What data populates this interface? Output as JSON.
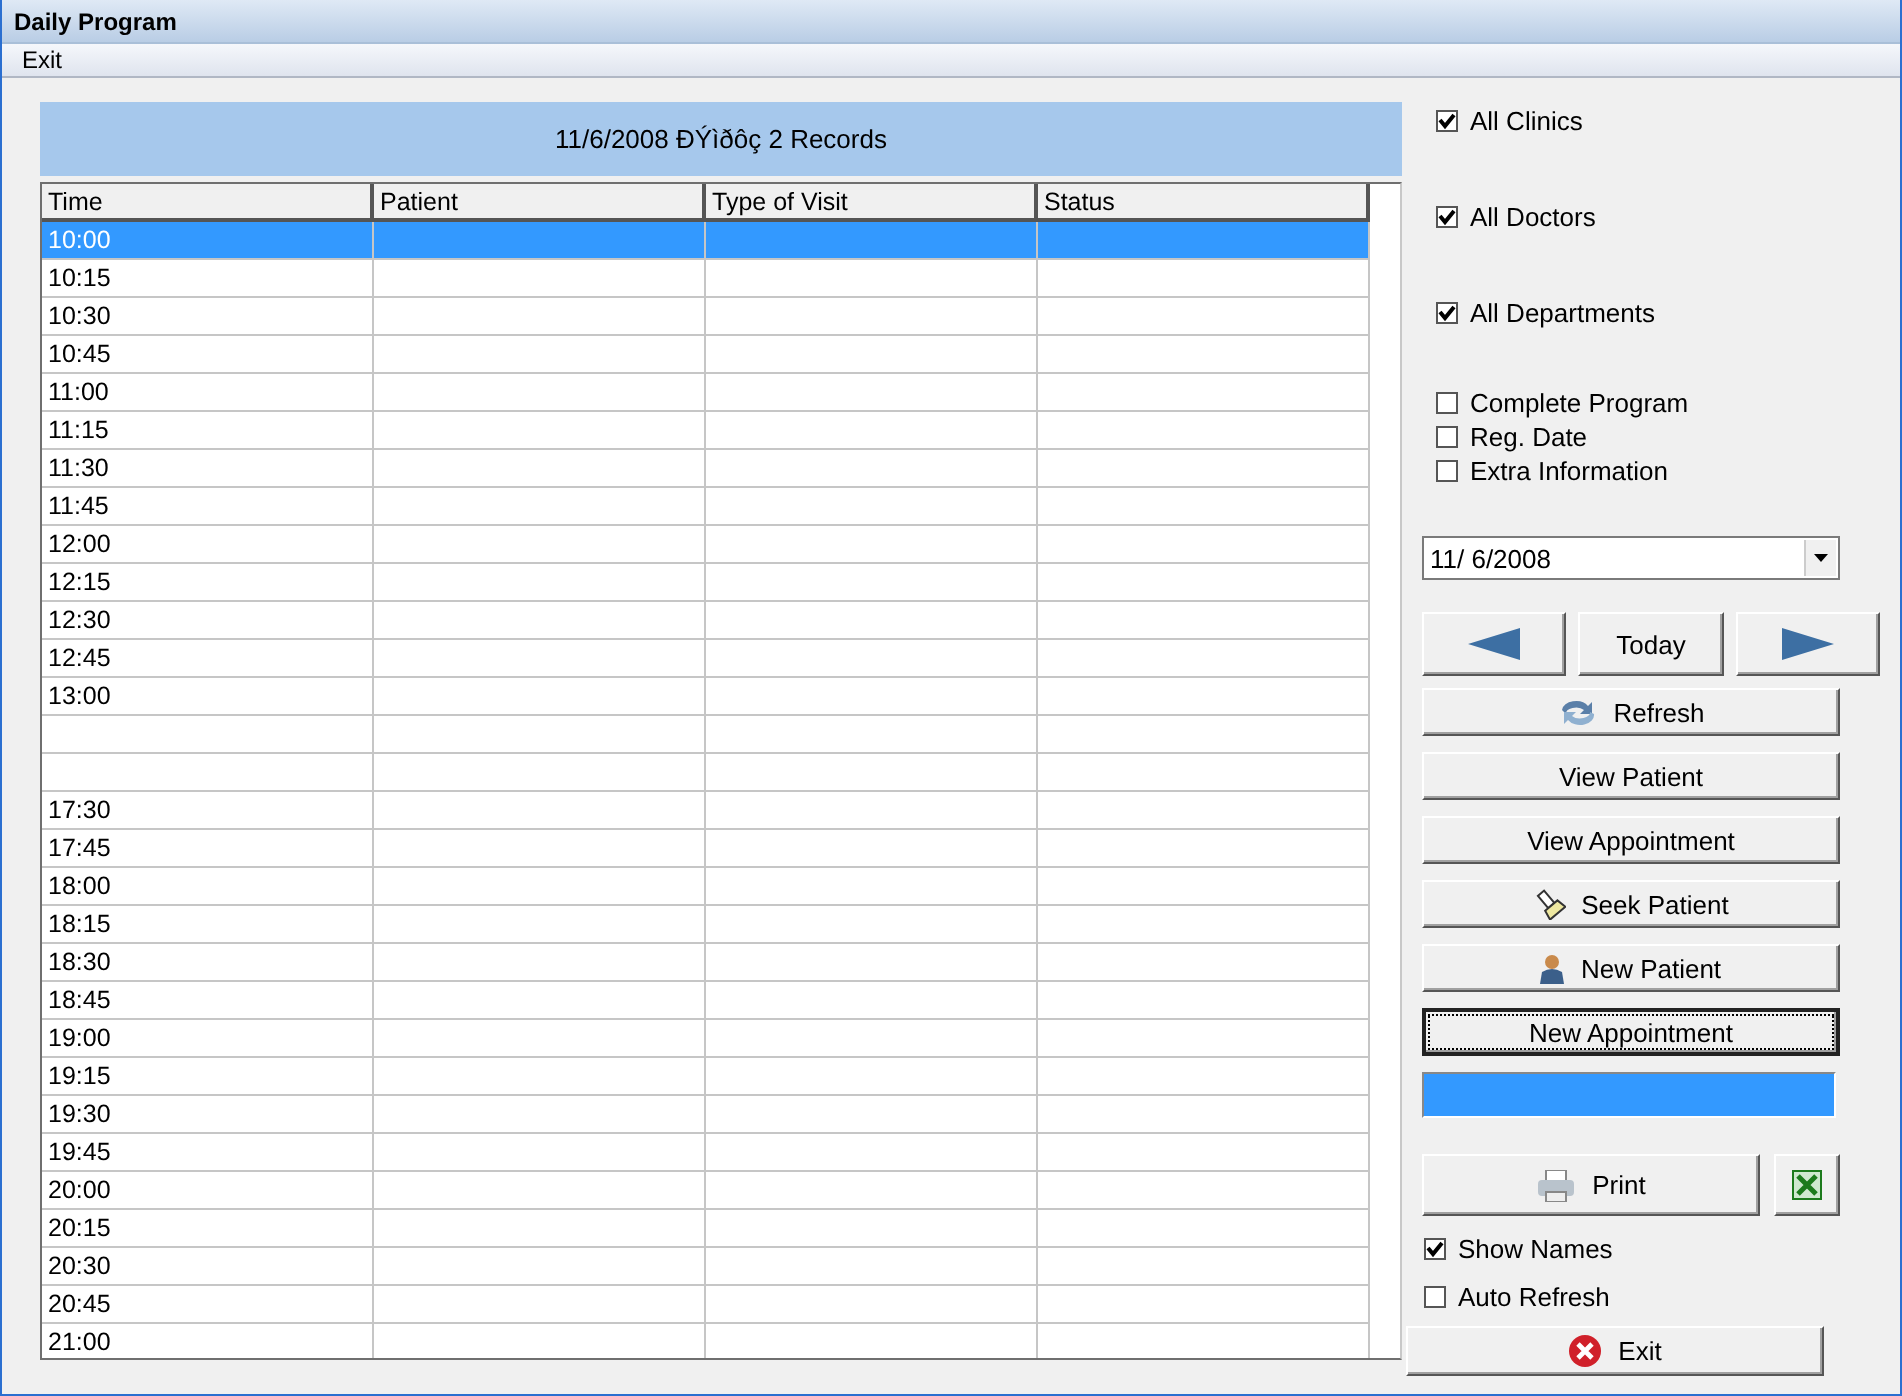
{
  "window": {
    "title": "Daily Program"
  },
  "menu": [
    {
      "label": "Exit"
    }
  ],
  "header": {
    "text": "11/6/2008 ÐÝìðôç 2 Records"
  },
  "table": {
    "columns": [
      "Time",
      "Patient",
      "Type of Visit",
      "Status"
    ],
    "rows": [
      {
        "time": "10:00",
        "selected": true
      },
      {
        "time": "10:15",
        "selected": false
      },
      {
        "time": "10:30",
        "selected": false
      },
      {
        "time": "10:45",
        "selected": false
      },
      {
        "time": "11:00",
        "selected": false
      },
      {
        "time": "11:15",
        "selected": false
      },
      {
        "time": "11:30",
        "selected": false
      },
      {
        "time": "11:45",
        "selected": false
      },
      {
        "time": "12:00",
        "selected": false
      },
      {
        "time": "12:15",
        "selected": false
      },
      {
        "time": "12:30",
        "selected": false
      },
      {
        "time": "12:45",
        "selected": false
      },
      {
        "time": "13:00",
        "selected": false
      },
      {
        "selected": false
      },
      {
        "selected": false
      },
      {
        "time": "17:30",
        "selected": false
      },
      {
        "time": "17:45",
        "selected": false
      },
      {
        "time": "18:00",
        "selected": false
      },
      {
        "time": "18:15",
        "selected": false
      },
      {
        "time": "18:30",
        "selected": false
      },
      {
        "time": "18:45",
        "selected": false
      },
      {
        "time": "19:00",
        "selected": false
      },
      {
        "time": "19:15",
        "selected": false
      },
      {
        "time": "19:30",
        "selected": false
      },
      {
        "time": "19:45",
        "selected": false
      },
      {
        "time": "20:00",
        "selected": false
      },
      {
        "time": "20:15",
        "selected": false
      },
      {
        "time": "20:30",
        "selected": false
      },
      {
        "time": "20:45",
        "selected": false
      },
      {
        "time": "21:00",
        "selected": false
      }
    ]
  },
  "filters": [
    {
      "label": "All Clinics",
      "checked": true
    },
    {
      "label": "All Doctors",
      "checked": true
    },
    {
      "label": "All Departments",
      "checked": true
    }
  ],
  "options": [
    {
      "label": "Complete Program",
      "checked": false
    },
    {
      "label": "Reg. Date",
      "checked": false
    },
    {
      "label": "Extra Information",
      "checked": false
    }
  ],
  "date_picker": {
    "value": "11/  6/2008"
  },
  "nav": {
    "today": "Today"
  },
  "actions": [
    {
      "label": "Refresh",
      "focused": false
    },
    {
      "label": "View Patient",
      "focused": false
    },
    {
      "label": "View Appointment",
      "focused": false
    },
    {
      "label": "Seek Patient",
      "focused": false
    },
    {
      "label": "New Patient",
      "focused": false
    },
    {
      "label": "New Appointment",
      "focused": true
    }
  ],
  "print": {
    "label": "Print"
  },
  "display": [
    {
      "label": "Show Names",
      "checked": true
    },
    {
      "label": "Auto Refresh",
      "checked": false
    }
  ],
  "exit": {
    "label": "Exit"
  }
}
